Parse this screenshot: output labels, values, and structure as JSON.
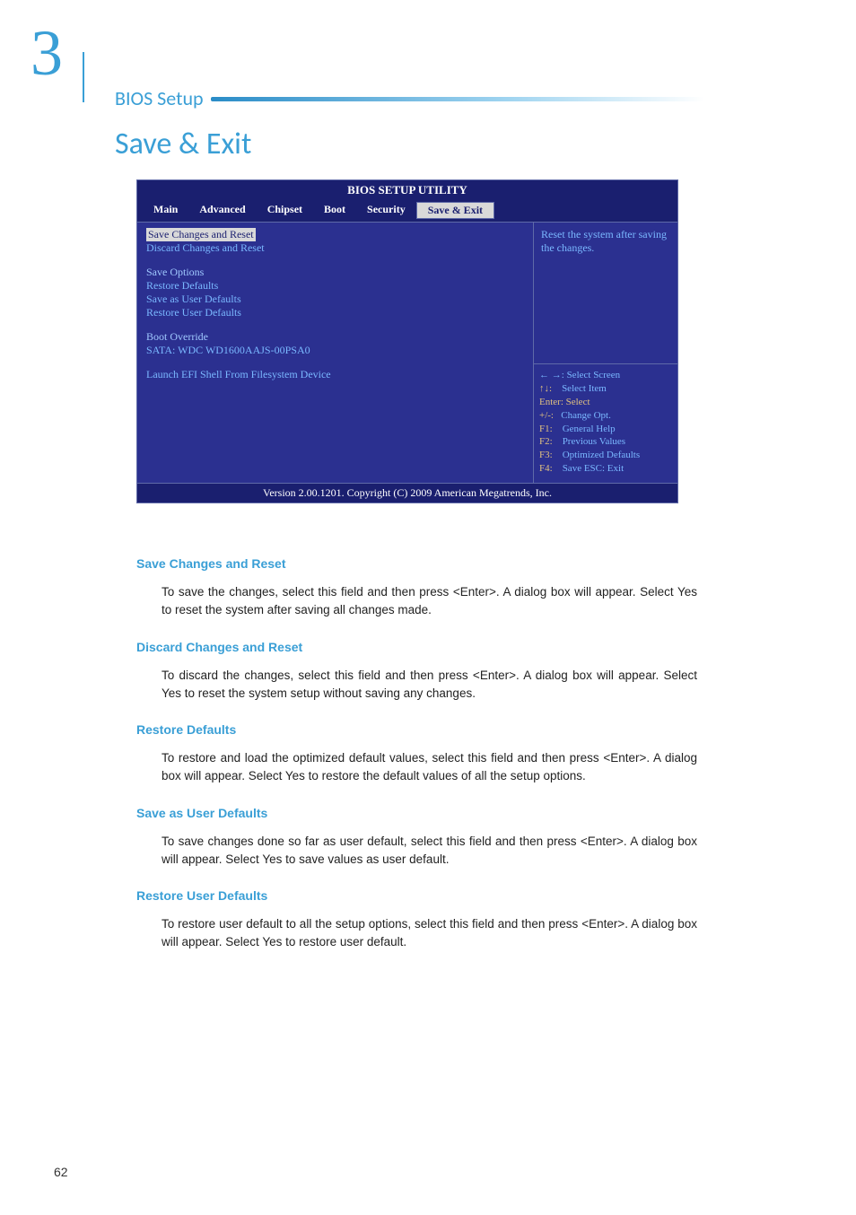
{
  "header": {
    "chapter_number": "3",
    "chapter_title": "BIOS Setup"
  },
  "page_title": "Save & Exit",
  "bios": {
    "title": "BIOS SETUP UTILITY",
    "tabs": [
      "Main",
      "Advanced",
      "Chipset",
      "Boot",
      "Security",
      "Save & Exit"
    ],
    "active_tab": "Save & Exit",
    "left_panel": {
      "selected_item": "Save Changes and Reset",
      "item2": "Discard Changes and Reset",
      "group1_label": "Save Options",
      "group1_items": [
        "Restore Defaults",
        "Save as User Defaults",
        "Restore User Defaults"
      ],
      "group2_label": "Boot Override",
      "group2_items": [
        "SATA: WDC WD1600AAJS-00PSA0"
      ],
      "extra_item": "Launch EFI Shell From Filesystem Device"
    },
    "help_text": "Reset the system after saving the changes.",
    "keys": {
      "l1_k": "← →:",
      "l1_v": "Select Screen",
      "l2_k": "↑↓:",
      "l2_v": "Select Item",
      "l3": "Enter: Select",
      "l4_k": "+/-:",
      "l4_v": "Change Opt.",
      "l5_k": "F1:",
      "l5_v": "General Help",
      "l6_k": "F2:",
      "l6_v": "Previous Values",
      "l7_k": "F3:",
      "l7_v": "Optimized Defaults",
      "l8_k": "F4:",
      "l8_v": "Save   ESC: Exit"
    },
    "footer": "Version 2.00.1201. Copyright (C) 2009 American Megatrends, Inc."
  },
  "descriptions": [
    {
      "title": "Save Changes and Reset",
      "text": "To save the changes, select this field and then press <Enter>. A dialog box will appear. Select Yes to reset the system after saving all changes made."
    },
    {
      "title": "Discard Changes and Reset",
      "text": "To discard the changes, select this field and then press <Enter>. A dialog box will appear. Select Yes to reset the system setup without saving any changes."
    },
    {
      "title": "Restore Defaults",
      "text": "To restore and load the optimized default values, select this field and then press <Enter>. A dialog box will appear. Select Yes to restore the default values of all the setup options."
    },
    {
      "title": "Save as User Defaults",
      "text": "To save changes done so far as user default, select this field and then press <Enter>. A dialog box will appear. Select Yes to save values as user default."
    },
    {
      "title": "Restore User Defaults",
      "text": "To restore user default to all the setup options, select this field and then press <Enter>. A dialog box will appear. Select Yes to restore user default."
    }
  ],
  "page_number": "62"
}
